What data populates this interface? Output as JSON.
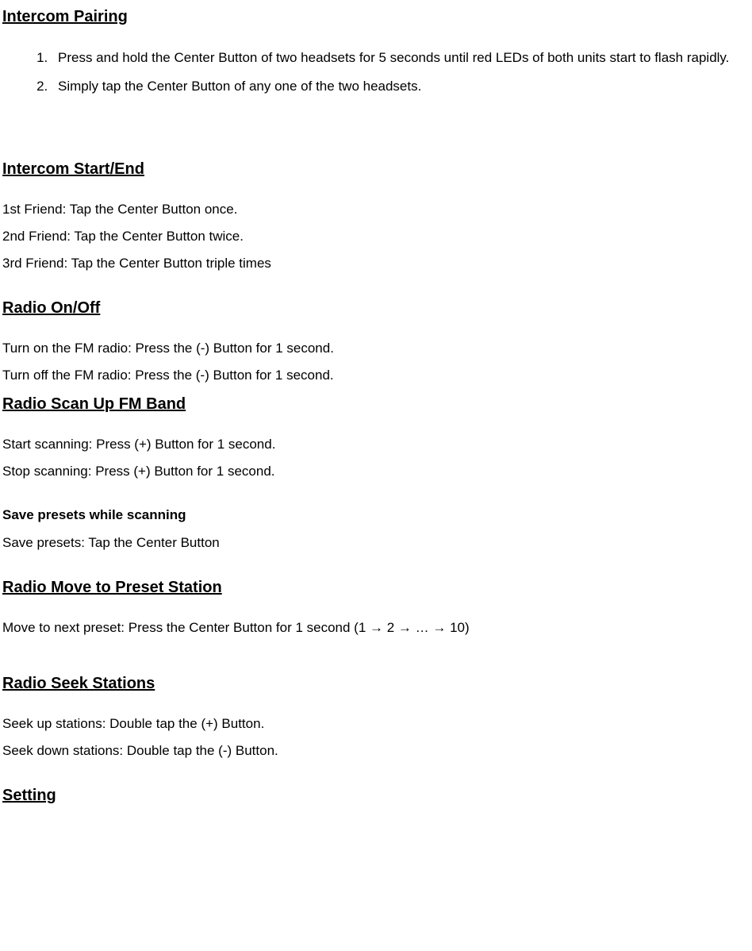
{
  "sections": {
    "intercom_pairing": {
      "heading": "Intercom Pairing",
      "steps": [
        "Press and hold the Center Button of two headsets for 5 seconds until red LEDs of both units start to flash rapidly.",
        "Simply tap the Center Button of any one of the two headsets."
      ]
    },
    "intercom_start_end": {
      "heading": "Intercom Start/End",
      "lines": [
        "1st Friend: Tap the Center Button once.",
        "2nd Friend: Tap the Center Button twice.",
        "3rd Friend: Tap the Center Button triple times"
      ]
    },
    "radio_on_off": {
      "heading": "Radio On/Off",
      "lines": [
        "Turn on the FM radio: Press the (-) Button for 1 second.",
        "Turn off the FM radio: Press the (-) Button for 1 second."
      ]
    },
    "radio_scan": {
      "heading": "Radio Scan Up FM Band",
      "lines": [
        "Start scanning: Press (+) Button for 1 second.",
        "Stop scanning: Press (+) Button for 1 second."
      ]
    },
    "save_presets": {
      "heading": "Save presets while scanning",
      "line": "Save presets: Tap the Center Button"
    },
    "radio_move_preset": {
      "heading": "Radio Move to Preset Station",
      "line": "Move to next preset: Press the Center Button for 1 second (1 → 2 → … → 10)"
    },
    "radio_seek": {
      "heading": "Radio Seek Stations",
      "lines": [
        "Seek up stations: Double tap the (+) Button.",
        "Seek down stations: Double tap the (-) Button."
      ]
    },
    "setting": {
      "heading": "Setting"
    }
  }
}
